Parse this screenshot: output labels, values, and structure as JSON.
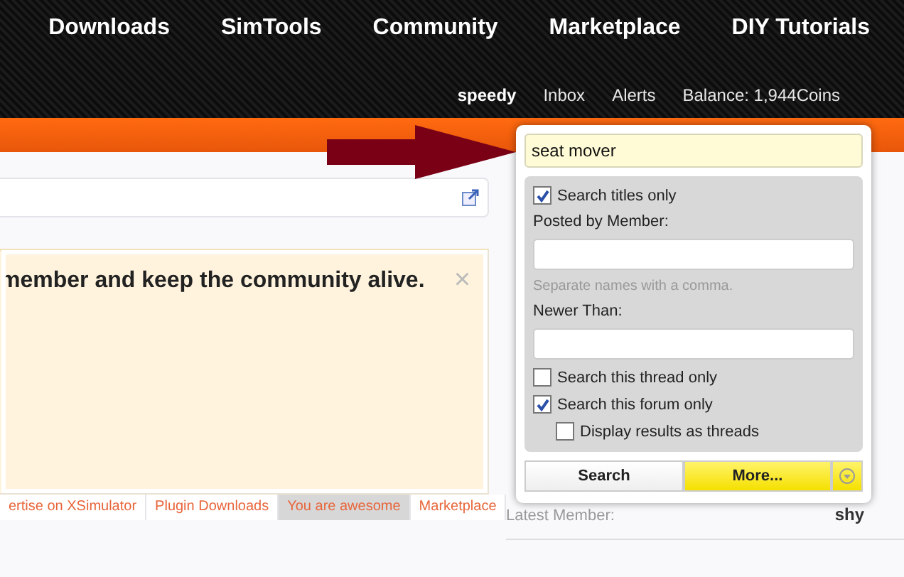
{
  "nav": {
    "items": [
      {
        "label": "Downloads"
      },
      {
        "label": "SimTools"
      },
      {
        "label": "Community"
      },
      {
        "label": "Marketplace"
      },
      {
        "label": "DIY Tutorials"
      }
    ]
  },
  "user_bar": {
    "username": "speedy",
    "links": [
      "Inbox",
      "Alerts",
      "Balance: 1,944Coins"
    ]
  },
  "notice": {
    "message": "member and keep the community alive.",
    "close": "×"
  },
  "notice_tabs": [
    {
      "label": "ertise on XSimulator",
      "selected": false
    },
    {
      "label": "Plugin Downloads",
      "selected": false
    },
    {
      "label": "You are awesome",
      "selected": true
    },
    {
      "label": "Marketplace",
      "selected": false
    }
  ],
  "sidebar": {
    "label": "Latest Member:",
    "value": "shy"
  },
  "search_popup": {
    "query": "seat mover",
    "options": [
      {
        "kind": "checkbox",
        "label": "Search titles only",
        "checked": true
      },
      {
        "kind": "label",
        "label": "Posted by Member:"
      },
      {
        "kind": "field"
      },
      {
        "kind": "hint",
        "label": "Separate names with a comma."
      },
      {
        "kind": "label",
        "label": "Newer Than:"
      },
      {
        "kind": "field"
      },
      {
        "kind": "checkbox",
        "label": "Search this thread only",
        "checked": false
      },
      {
        "kind": "checkbox",
        "label": "Search this forum only",
        "checked": true
      },
      {
        "kind": "subcheckbox",
        "label": "Display results as threads",
        "checked": false
      }
    ],
    "buttons": [
      "Search",
      "More..."
    ]
  }
}
